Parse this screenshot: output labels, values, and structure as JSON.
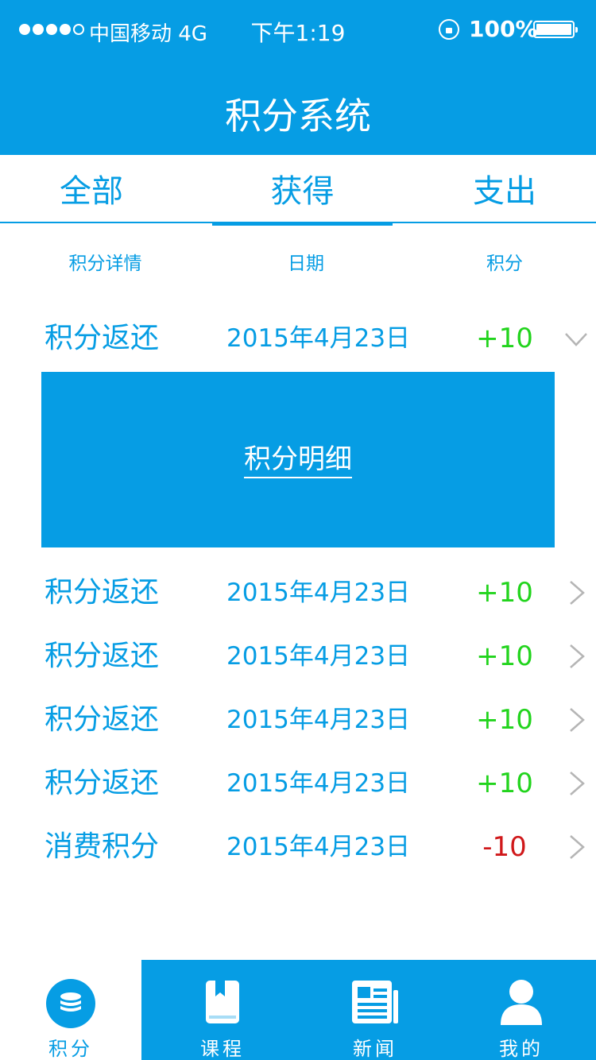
{
  "status_bar": {
    "carrier": "中国移动 4G",
    "time": "下午1:19",
    "battery": "100%"
  },
  "header": {
    "title": "积分系统"
  },
  "tabs": [
    {
      "label": "全部"
    },
    {
      "label": "获得"
    },
    {
      "label": "支出"
    }
  ],
  "active_tab": "获得",
  "columns": {
    "detail": "积分详情",
    "date": "日期",
    "points": "积分"
  },
  "rows": [
    {
      "desc": "积分返还",
      "date": "2015年4月23日",
      "points": "+10",
      "expanded": true
    },
    {
      "desc": "积分返还",
      "date": "2015年4月23日",
      "points": "+10"
    },
    {
      "desc": "积分返还",
      "date": "2015年4月23日",
      "points": "+10"
    },
    {
      "desc": "积分返还",
      "date": "2015年4月23日",
      "points": "+10"
    },
    {
      "desc": "积分返还",
      "date": "2015年4月23日",
      "points": "+10"
    },
    {
      "desc": "消费积分",
      "date": "2015年4月23日",
      "points": "-10"
    }
  ],
  "expanded_panel": {
    "link_label": "积分明细"
  },
  "bottom_nav": [
    {
      "label": "积分",
      "icon": "coin-stack-icon"
    },
    {
      "label": "课程",
      "icon": "bookmark-book-icon"
    },
    {
      "label": "新闻",
      "icon": "newspaper-icon"
    },
    {
      "label": "我的",
      "icon": "user-icon"
    }
  ],
  "colors": {
    "accent": "#069de4",
    "positive": "#22d41d",
    "negative": "#d0181a",
    "chevron": "#b5b5b5"
  }
}
